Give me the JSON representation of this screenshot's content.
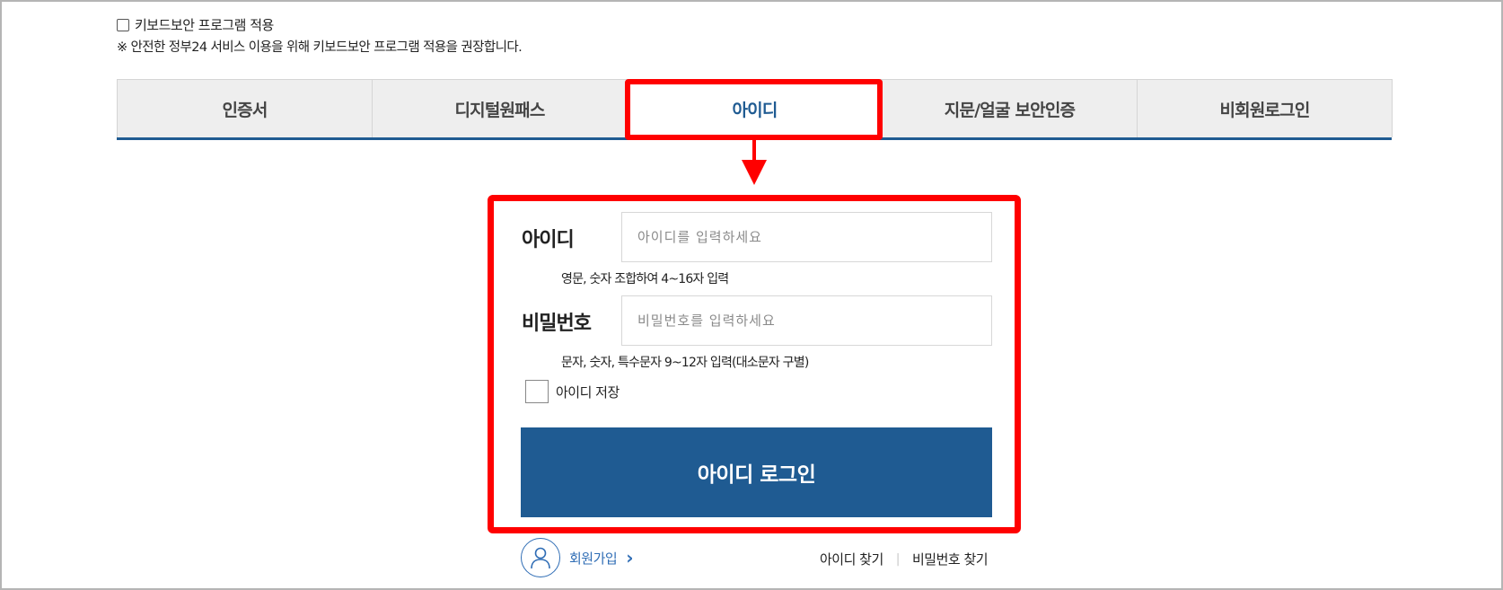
{
  "keyboard_security": {
    "checkbox_label": "키보드보안 프로그램 적용",
    "checked": false,
    "notice": "※ 안전한 정부24 서비스 이용을 위해 키보드보안 프로그램 적용을 권장합니다."
  },
  "tabs": [
    {
      "label": "인증서",
      "active": false
    },
    {
      "label": "디지털원패스",
      "active": false
    },
    {
      "label": "아이디",
      "active": true
    },
    {
      "label": "지문/얼굴 보안인증",
      "active": false
    },
    {
      "label": "비회원로그인",
      "active": false
    }
  ],
  "form": {
    "id_label": "아이디",
    "id_placeholder": "아이디를 입력하세요",
    "id_hint": "영문, 숫자 조합하여 4~16자 입력",
    "password_label": "비밀번호",
    "password_placeholder": "비밀번호를 입력하세요",
    "password_hint": "문자, 숫자, 특수문자 9~12자 입력(대소문자 구별)",
    "save_id_label": "아이디 저장",
    "save_id_checked": false,
    "login_button": "아이디 로그인"
  },
  "footer": {
    "signup_label": "회원가입",
    "signup_icon": "user-icon",
    "find_id": "아이디 찾기",
    "separator": "|",
    "find_password": "비밀번호 찾기"
  },
  "colors": {
    "primary": "#1f5b92",
    "highlight": "#ff0000",
    "link": "#2f6db5"
  }
}
